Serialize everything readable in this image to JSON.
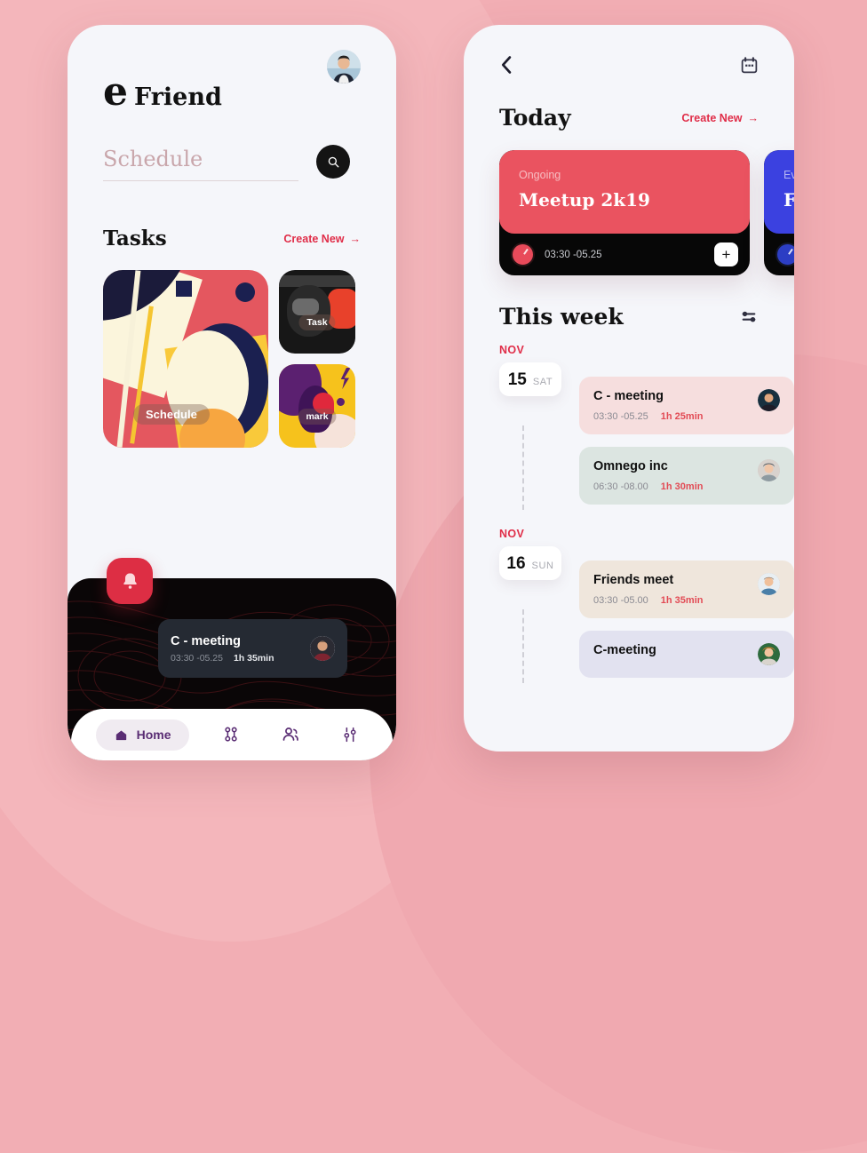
{
  "theme": {
    "page_bg": "#F2AEB4",
    "screen_bg": "#F5F6FA",
    "accent_red": "#E02D48",
    "card_red": "#EA5360",
    "card_blue": "#3B41E0",
    "nav_purple": "#5A2D74",
    "dark": "#0A0607"
  },
  "left_phone": {
    "avatar": "user-avatar",
    "brand": {
      "mark": "e",
      "name": "Friend"
    },
    "search": {
      "placeholder": "Schedule",
      "value": "",
      "icon": "search-icon"
    },
    "tasks_section": {
      "title": "Tasks",
      "create_new": "Create New",
      "arrow": "→",
      "cards": [
        {
          "label": "Schedule",
          "art": "abstract-collage"
        },
        {
          "label": "Task",
          "art": "dark-machine"
        },
        {
          "label": "mark",
          "art": "yellow-purple-bird"
        }
      ]
    },
    "bell_button": {
      "icon": "bell-icon"
    },
    "mini_card": {
      "title": "C - meeting",
      "time": "03:30 -05.25",
      "duration": "1h 35min",
      "avatar": "attendee-avatar"
    },
    "nav": [
      {
        "label": "Home",
        "icon": "home-icon",
        "active": true
      },
      {
        "label": "",
        "icon": "nodes-icon",
        "active": false
      },
      {
        "label": "",
        "icon": "people-icon",
        "active": false
      },
      {
        "label": "",
        "icon": "sliders-icon",
        "active": false
      }
    ]
  },
  "right_phone": {
    "header": {
      "back_icon": "chevron-left-icon",
      "calendar_icon": "calendar-icon"
    },
    "today_section": {
      "title": "Today",
      "create_new": "Create New",
      "arrow": "→",
      "cards": [
        {
          "status": "Ongoing",
          "name": "Meetup 2k19",
          "time": "03:30 -05.25",
          "color": "#EA5360",
          "add_icon": "plus-icon",
          "partial": false
        },
        {
          "status": "Ev",
          "name": "F",
          "time": "",
          "color": "#3B41E0",
          "add_icon": "plus-icon",
          "partial": true
        }
      ]
    },
    "week_section": {
      "title": "This week",
      "filter_icon": "sliders-icon",
      "days": [
        {
          "month": "NOV",
          "day": "15",
          "dow": "SAT",
          "events": [
            {
              "title": "C - meeting",
              "time": "03:30 -05.25",
              "duration": "1h 25min",
              "color": "#F6DEDE",
              "avatar": "attendee-avatar-1"
            },
            {
              "title": "Omnego inc",
              "time": "06:30 -08.00",
              "duration": "1h 30min",
              "color": "#DCE5E1",
              "avatar": "attendee-avatar-2"
            }
          ]
        },
        {
          "month": "NOV",
          "day": "16",
          "dow": "SUN",
          "events": [
            {
              "title": "Friends meet",
              "time": "03:30 -05.00",
              "duration": "1h 35min",
              "color": "#EFE6DC",
              "avatar": "attendee-avatar-3"
            },
            {
              "title": "C-meeting",
              "time": "",
              "duration": "",
              "color": "#E2E2F0",
              "avatar": "attendee-avatar-4"
            }
          ]
        }
      ]
    }
  }
}
